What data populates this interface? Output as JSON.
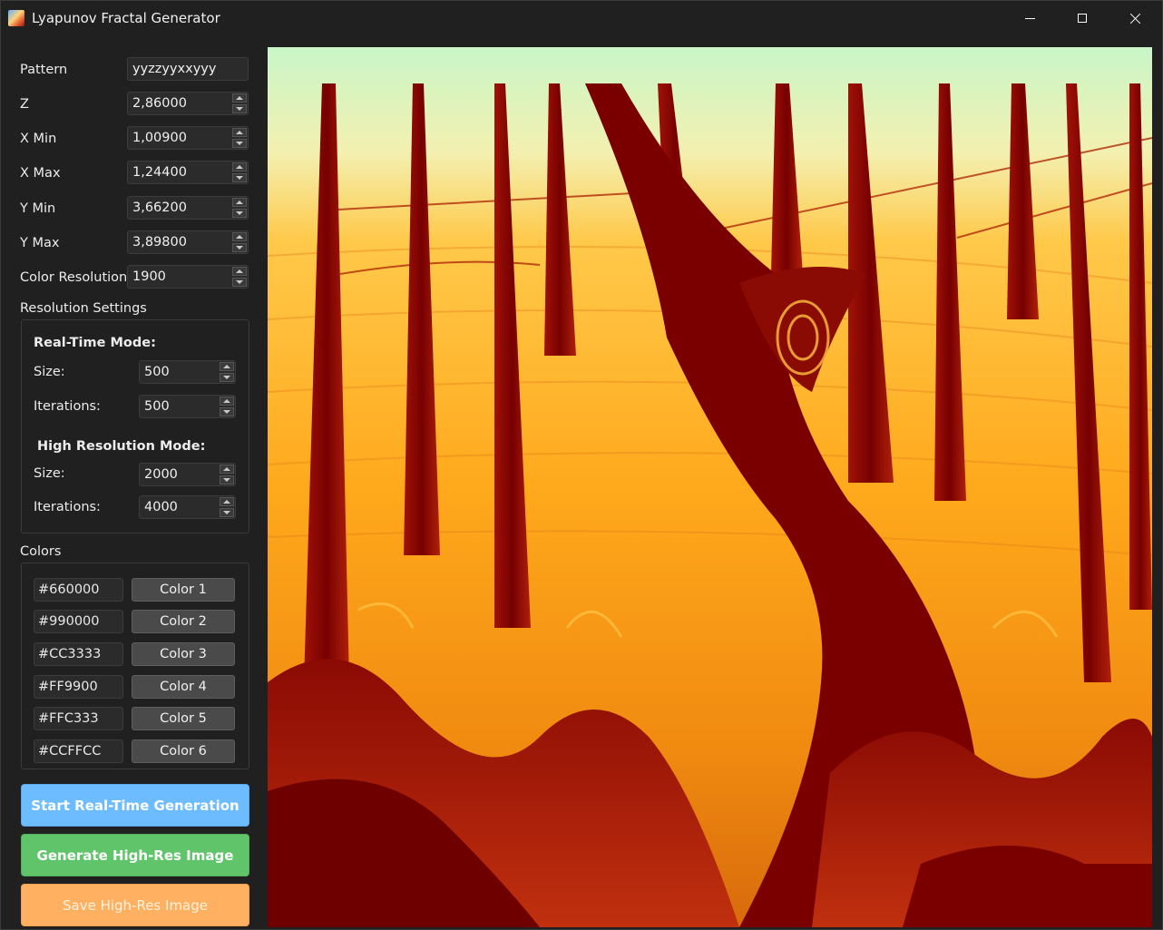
{
  "window": {
    "title": "Lyapunov Fractal Generator",
    "app_icon": "fractal-app-icon"
  },
  "controls": {
    "pattern": {
      "label": "Pattern",
      "value": "yyzzyyxxyyy"
    },
    "z": {
      "label": "Z",
      "value": "2,86000"
    },
    "x_min": {
      "label": "X Min",
      "value": "1,00900"
    },
    "x_max": {
      "label": "X Max",
      "value": "1,24400"
    },
    "y_min": {
      "label": "Y Min",
      "value": "3,66200"
    },
    "y_max": {
      "label": "Y Max",
      "value": "3,89800"
    },
    "color_resolution": {
      "label": "Color Resolution",
      "value": "1900"
    }
  },
  "resolution": {
    "heading": "Resolution Settings",
    "realtime": {
      "title": "Real-Time Mode:",
      "size_label": "Size:",
      "size": "500",
      "iter_label": "Iterations:",
      "iterations": "500"
    },
    "highres": {
      "title": "High Resolution Mode:",
      "size_label": "Size:",
      "size": "2000",
      "iter_label": "Iterations:",
      "iterations": "4000"
    }
  },
  "colors": {
    "heading": "Colors",
    "items": [
      {
        "hex": "#660000",
        "button": "Color 1"
      },
      {
        "hex": "#990000",
        "button": "Color 2"
      },
      {
        "hex": "#CC3333",
        "button": "Color 3"
      },
      {
        "hex": "#FF9900",
        "button": "Color 4"
      },
      {
        "hex": "#FFC333",
        "button": "Color 5"
      },
      {
        "hex": "#CCFFCC",
        "button": "Color 6"
      }
    ]
  },
  "actions": {
    "start_realtime": "Start Real-Time Generation",
    "generate_highres": "Generate High-Res Image",
    "save_highres": "Save High-Res Image"
  },
  "theme": {
    "background": "#202020",
    "accent_blue": "#6cbcff",
    "accent_green": "#5fc46a",
    "accent_orange": "#ffb060"
  }
}
